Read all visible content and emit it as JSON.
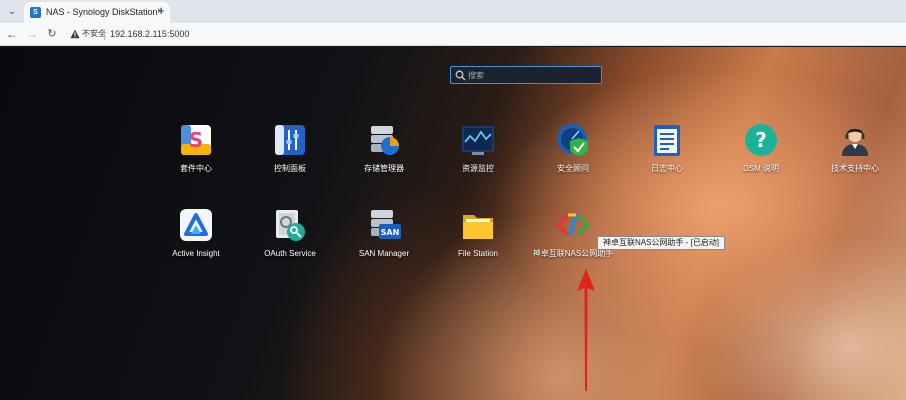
{
  "browser": {
    "tab_title": "NAS - Synology DiskStation",
    "tab_favicon": "S",
    "tab_close": "×",
    "new_tab": "+",
    "dropdown": "⌄",
    "back": "←",
    "forward": "→",
    "reload": "↻",
    "security_label": "不安全",
    "url": "192.168.2.115:5000"
  },
  "search": {
    "placeholder": "搜索"
  },
  "apps_row1": [
    {
      "label": "套件中心",
      "icon": "package-center-icon"
    },
    {
      "label": "控制面板",
      "icon": "control-panel-icon"
    },
    {
      "label": "存储管理器",
      "icon": "storage-manager-icon"
    },
    {
      "label": "资源监控",
      "icon": "resource-monitor-icon"
    },
    {
      "label": "安全顾问",
      "icon": "security-advisor-icon"
    },
    {
      "label": "日志中心",
      "icon": "log-center-icon"
    },
    {
      "label": "DSM 说明",
      "icon": "dsm-help-icon"
    },
    {
      "label": "技术支持中心",
      "icon": "support-center-icon"
    }
  ],
  "apps_row2": [
    {
      "label": "Active Insight",
      "icon": "active-insight-icon"
    },
    {
      "label": "OAuth Service",
      "icon": "oauth-service-icon"
    },
    {
      "label": "SAN Manager",
      "icon": "san-manager-icon",
      "badge": "SAN"
    },
    {
      "label": "File Station",
      "icon": "file-station-icon"
    },
    {
      "label": "神卓互联NAS公网助手",
      "icon": "shenzhuo-nas-icon"
    }
  ],
  "tooltip": "神卓互联NAS公网助手 - [已启动]",
  "colors": {
    "accent": "#3f93d8",
    "arrow": "#e2231a"
  }
}
